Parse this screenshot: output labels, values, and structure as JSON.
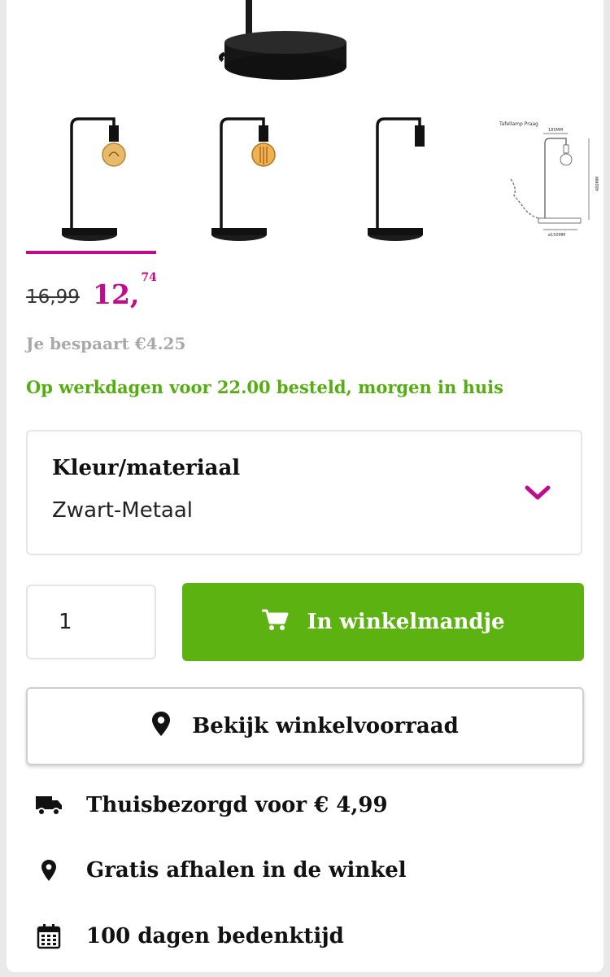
{
  "gallery": {
    "thumbnails": [
      {
        "name": "lamp-bulb-on-1",
        "active": true
      },
      {
        "name": "lamp-bulb-on-2",
        "active": false
      },
      {
        "name": "lamp-no-bulb",
        "active": false
      },
      {
        "name": "lamp-dimensions",
        "active": false
      }
    ],
    "dimension_drawing": {
      "title": "Tafellamp Praag",
      "width_label": "185MM",
      "height_label": "480MM",
      "base_label": "ø150MM"
    }
  },
  "price": {
    "old": "16,99",
    "new_main": "12,",
    "new_cents": "74",
    "saving": "Je bespaart €4.25",
    "delivery_promise": "Op werkdagen voor 22.00 besteld, morgen in huis"
  },
  "variant": {
    "label": "Kleur/materiaal",
    "value": "Zwart-Metaal"
  },
  "purchase": {
    "quantity": "1",
    "add_to_cart_label": "In winkelmandje",
    "store_stock_label": "Bekijk winkelvoorraad"
  },
  "usps": [
    {
      "icon": "truck-icon",
      "text": "Thuisbezorgd voor € 4,99"
    },
    {
      "icon": "location-pin-icon",
      "text": "Gratis afhalen in de winkel"
    },
    {
      "icon": "calendar-icon",
      "text": "100 dagen bedenktijd"
    }
  ],
  "colors": {
    "accent": "#c30a8e",
    "green": "#5bb210",
    "promise_green": "#55ae11",
    "muted": "#a9a9a9"
  }
}
